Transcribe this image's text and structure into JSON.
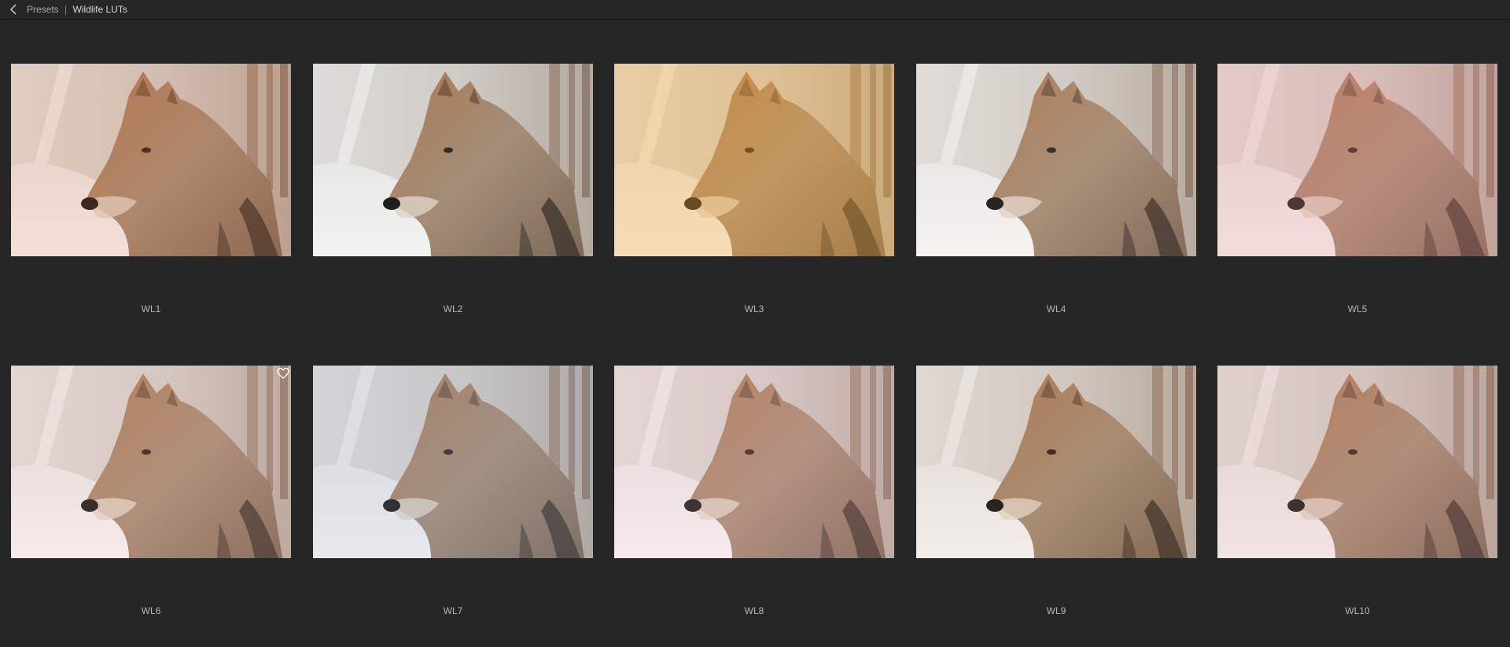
{
  "header": {
    "back_icon": "chevron-left-icon",
    "breadcrumb_parent": "Presets",
    "breadcrumb_separator": "|",
    "breadcrumb_current": "Wildlife LUTs"
  },
  "presets": [
    {
      "label": "WL1",
      "tint": "#c8724a",
      "tint_opacity": 0.22,
      "favorite": false
    },
    {
      "label": "WL2",
      "tint": "#8a8a80",
      "tint_opacity": 0.1,
      "favorite": false
    },
    {
      "label": "WL3",
      "tint": "#e9a63c",
      "tint_opacity": 0.38,
      "favorite": false
    },
    {
      "label": "WL4",
      "tint": "#b89d8a",
      "tint_opacity": 0.12,
      "favorite": false
    },
    {
      "label": "WL5",
      "tint": "#d98a8a",
      "tint_opacity": 0.3,
      "favorite": false
    },
    {
      "label": "WL6",
      "tint": "#d49a92",
      "tint_opacity": 0.2,
      "favorite": true
    },
    {
      "label": "WL7",
      "tint": "#8f9ab0",
      "tint_opacity": 0.22,
      "favorite": false
    },
    {
      "label": "WL8",
      "tint": "#d9a0a8",
      "tint_opacity": 0.22,
      "favorite": false
    },
    {
      "label": "WL9",
      "tint": "#b08a6a",
      "tint_opacity": 0.14,
      "favorite": false
    },
    {
      "label": "WL10",
      "tint": "#c8908a",
      "tint_opacity": 0.24,
      "favorite": false
    }
  ],
  "icons": {
    "favorite": "heart-outline-icon"
  }
}
